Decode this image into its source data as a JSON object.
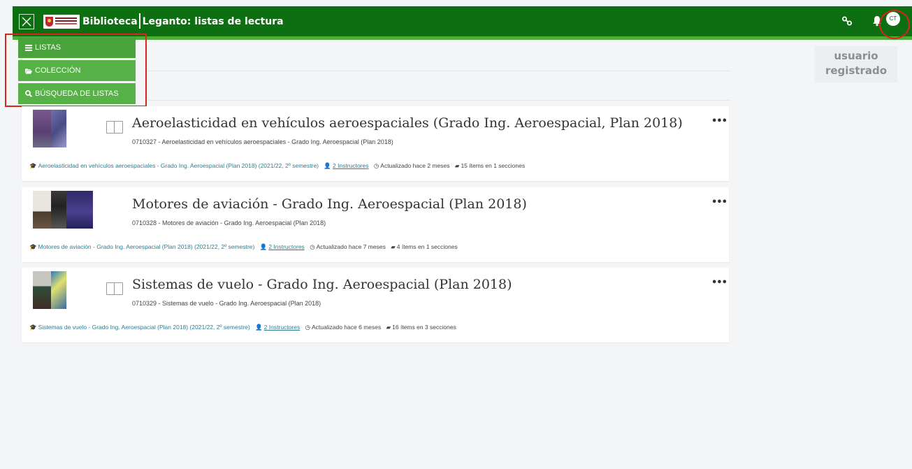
{
  "header": {
    "brand_biblioteca": "Biblioteca",
    "brand_leganto": "Leganto: listas de lectura",
    "avatar_initials": "CT",
    "colors": {
      "bar": "#0d6e12",
      "accent": "#4cad3a",
      "highlight": "#d7261c"
    }
  },
  "side_label": {
    "line1": "usuario",
    "line2": "registrado"
  },
  "menu": {
    "items": [
      {
        "label": "LISTAS",
        "icon": "list-icon"
      },
      {
        "label": "COLECCIÓN",
        "icon": "folder-icon"
      },
      {
        "label": "BÚSQUEDA DE LISTAS",
        "icon": "search-icon"
      }
    ]
  },
  "lists": [
    {
      "title": "Aeroelasticidad en vehículos aeroespaciales (Grado Ing. Aeroespacial, Plan 2018)",
      "subtitle": "0710327 - Aeroelasticidad en vehículos aeroespaciales - Grado Ing. Aeroespacial (Plan 2018)",
      "course": "Aeroelasticidad en vehículos aeroespaciales - Grado Ing. Aeroespacial (Plan 2018) (2021/22, 2º semestre)",
      "instructors": "2 Instructores",
      "updated": "Actualizado hace 2 meses",
      "items": "15 ítems en 1 secciones",
      "more": "•••"
    },
    {
      "title": "Motores de aviación - Grado Ing. Aeroespacial (Plan 2018)",
      "subtitle": "0710328 - Motores de aviación - Grado Ing. Aeroespacial (Plan 2018)",
      "course": "Motores de aviación - Grado Ing. Aeroespacial (Plan 2018) (2021/22, 2º semestre)",
      "instructors": "2 Instructores",
      "updated": "Actualizado hace 7 meses",
      "items": "4 ítems en 1 secciones",
      "more": "•••"
    },
    {
      "title": "Sistemas de vuelo - Grado Ing. Aeroespacial (Plan 2018)",
      "subtitle": "0710329 - Sistemas de vuelo - Grado Ing. Aeroespacial (Plan 2018)",
      "course": "Sistemas de vuelo - Grado Ing. Aeroespacial (Plan 2018) (2021/22, 2º semestre)",
      "instructors": "2 Instructores",
      "updated": "Actualizado hace 6 meses",
      "items": "16 ítems en 3 secciones",
      "more": "•••"
    }
  ]
}
